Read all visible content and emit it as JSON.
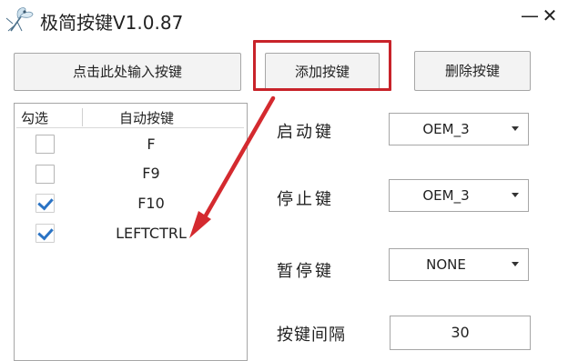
{
  "app": {
    "title": "极简按键V1.0.87",
    "minimize": "—",
    "close": "✕"
  },
  "toolbar": {
    "input_label": "点击此处输入按键",
    "add_label": "添加按键",
    "delete_label": "删除按键"
  },
  "key_list": {
    "col_check": "勾选",
    "col_key": "自动按键",
    "rows": [
      {
        "key": "F",
        "checked": false
      },
      {
        "key": "F9",
        "checked": false
      },
      {
        "key": "F10",
        "checked": true
      },
      {
        "key": "LEFTCTRL",
        "checked": true
      }
    ]
  },
  "settings": {
    "start_label": "启动键",
    "start_value": "OEM_3",
    "stop_label": "停止键",
    "stop_value": "OEM_3",
    "pause_label": "暂停键",
    "pause_value": "NONE",
    "interval_label": "按键间隔",
    "interval_value": "30"
  },
  "annotation": {
    "highlight_color": "#c8232a"
  },
  "icons": {
    "app": "mosquito-icon",
    "dropdown": "chevron-down-icon",
    "check": "checkmark-icon"
  }
}
